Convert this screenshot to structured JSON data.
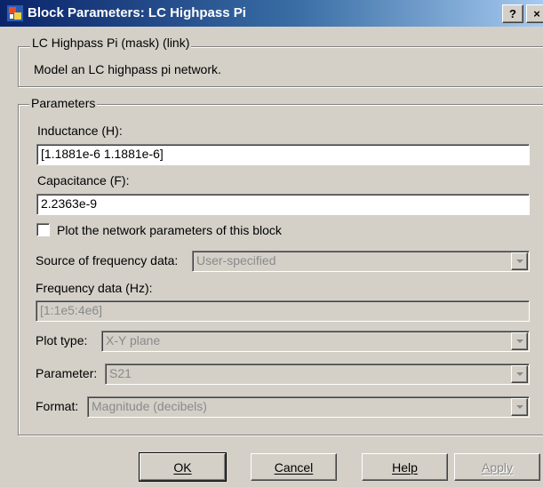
{
  "window": {
    "title": "Block Parameters: LC Highpass Pi",
    "help_label": "?",
    "close_label": "×"
  },
  "mask_group": {
    "legend": "LC Highpass Pi (mask) (link)",
    "description": "Model an LC highpass pi network."
  },
  "parameters": {
    "legend": "Parameters",
    "inductance": {
      "label": "Inductance (H):",
      "value": "[1.1881e-6  1.1881e-6]"
    },
    "capacitance": {
      "label": "Capacitance (F):",
      "value": "2.2363e-9"
    },
    "plot_checkbox": {
      "label": "Plot the network parameters of this block",
      "checked": false
    },
    "source": {
      "label": "Source of frequency data:",
      "value": "User-specified"
    },
    "frequency": {
      "label": "Frequency data (Hz):",
      "value": "[1:1e5:4e6]"
    },
    "plot_type": {
      "label": "Plot type:",
      "value": "X-Y plane"
    },
    "parameter": {
      "label": "Parameter:",
      "value": "S21"
    },
    "format": {
      "label": "Format:",
      "value": "Magnitude (decibels)"
    }
  },
  "buttons": {
    "ok": "OK",
    "cancel": "Cancel",
    "help": "Help",
    "apply": "Apply"
  }
}
